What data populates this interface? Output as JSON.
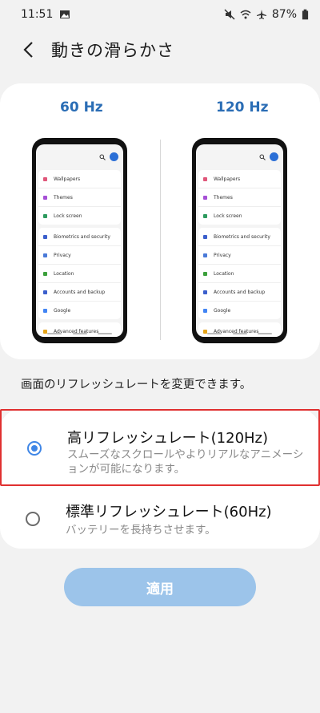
{
  "status_bar": {
    "time": "11:51",
    "battery": "87%",
    "icons": [
      "image-icon",
      "mute-icon",
      "wifi-icon",
      "airplane-icon",
      "battery-icon"
    ]
  },
  "header": {
    "title": "動きの滑らかさ",
    "back_icon": "chevron-left-icon"
  },
  "preview": {
    "left_label": "60 Hz",
    "right_label": "120 Hz",
    "phone_items_group1": [
      "Wallpapers",
      "Themes",
      "Lock screen"
    ],
    "phone_items_group2": [
      "Biometrics and security",
      "Privacy",
      "Location",
      "Accounts and backup",
      "Google"
    ],
    "phone_items_group3": [
      "Advanced features"
    ]
  },
  "description": "画面のリフレッシュレートを変更できます。",
  "options": [
    {
      "title": "高リフレッシュレート(120Hz)",
      "subtitle": "スムーズなスクロールやよりリアルなアニメーションが可能になります。",
      "selected": true
    },
    {
      "title": "標準リフレッシュレート(60Hz)",
      "subtitle": "バッテリーを長持ちさせます。",
      "selected": false
    }
  ],
  "apply_label": "適用",
  "colors": {
    "accent": "#3f86e6",
    "hz_label": "#2a6db5",
    "apply_disabled": "#9cc4ea",
    "highlight_border": "#e03030"
  }
}
